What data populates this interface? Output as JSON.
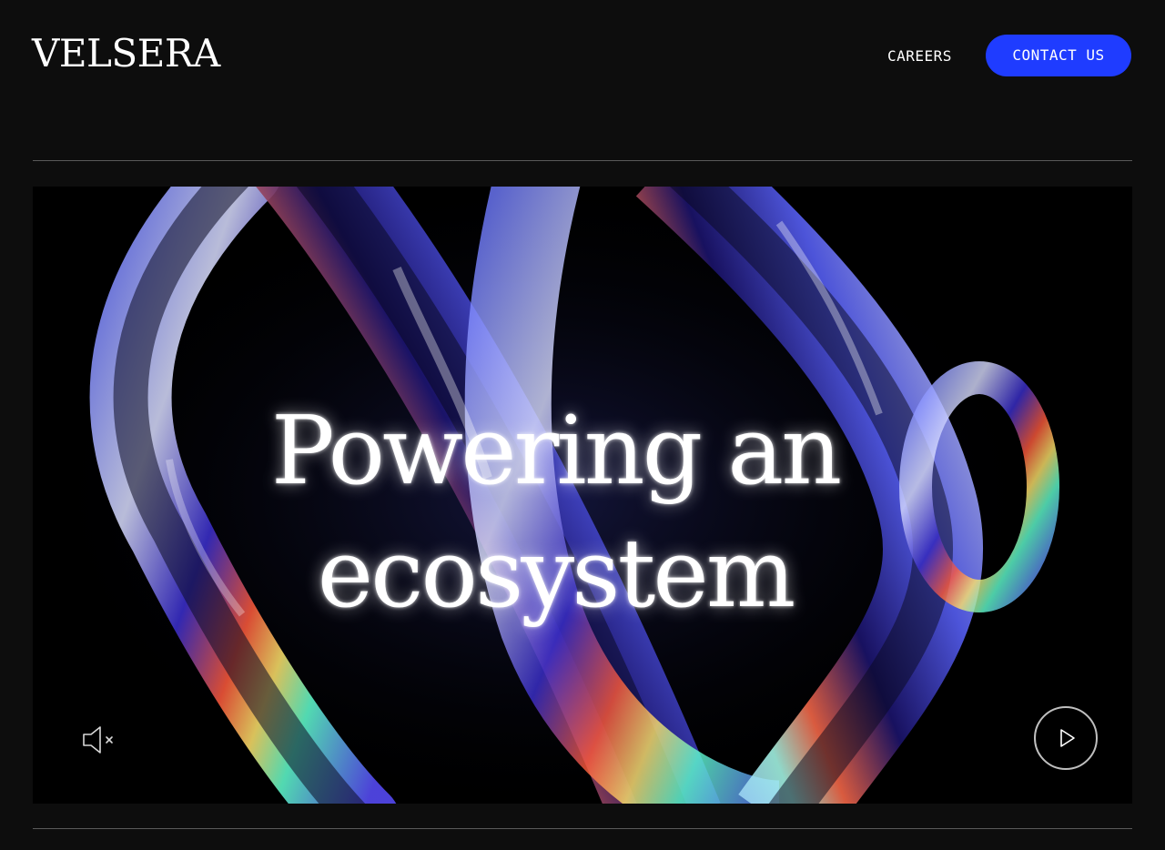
{
  "header": {
    "logo_text": "VELSERA",
    "nav": {
      "careers_label": "CAREERS",
      "contact_label": "CONTACT US"
    }
  },
  "hero": {
    "headline_line1": "Powering an",
    "headline_line2": "ecosystem",
    "controls": {
      "mute_icon": "speaker-muted-icon",
      "play_icon": "play-icon"
    }
  },
  "colors": {
    "background": "#0d0d0d",
    "accent": "#1f3cff",
    "text": "#ffffff"
  }
}
